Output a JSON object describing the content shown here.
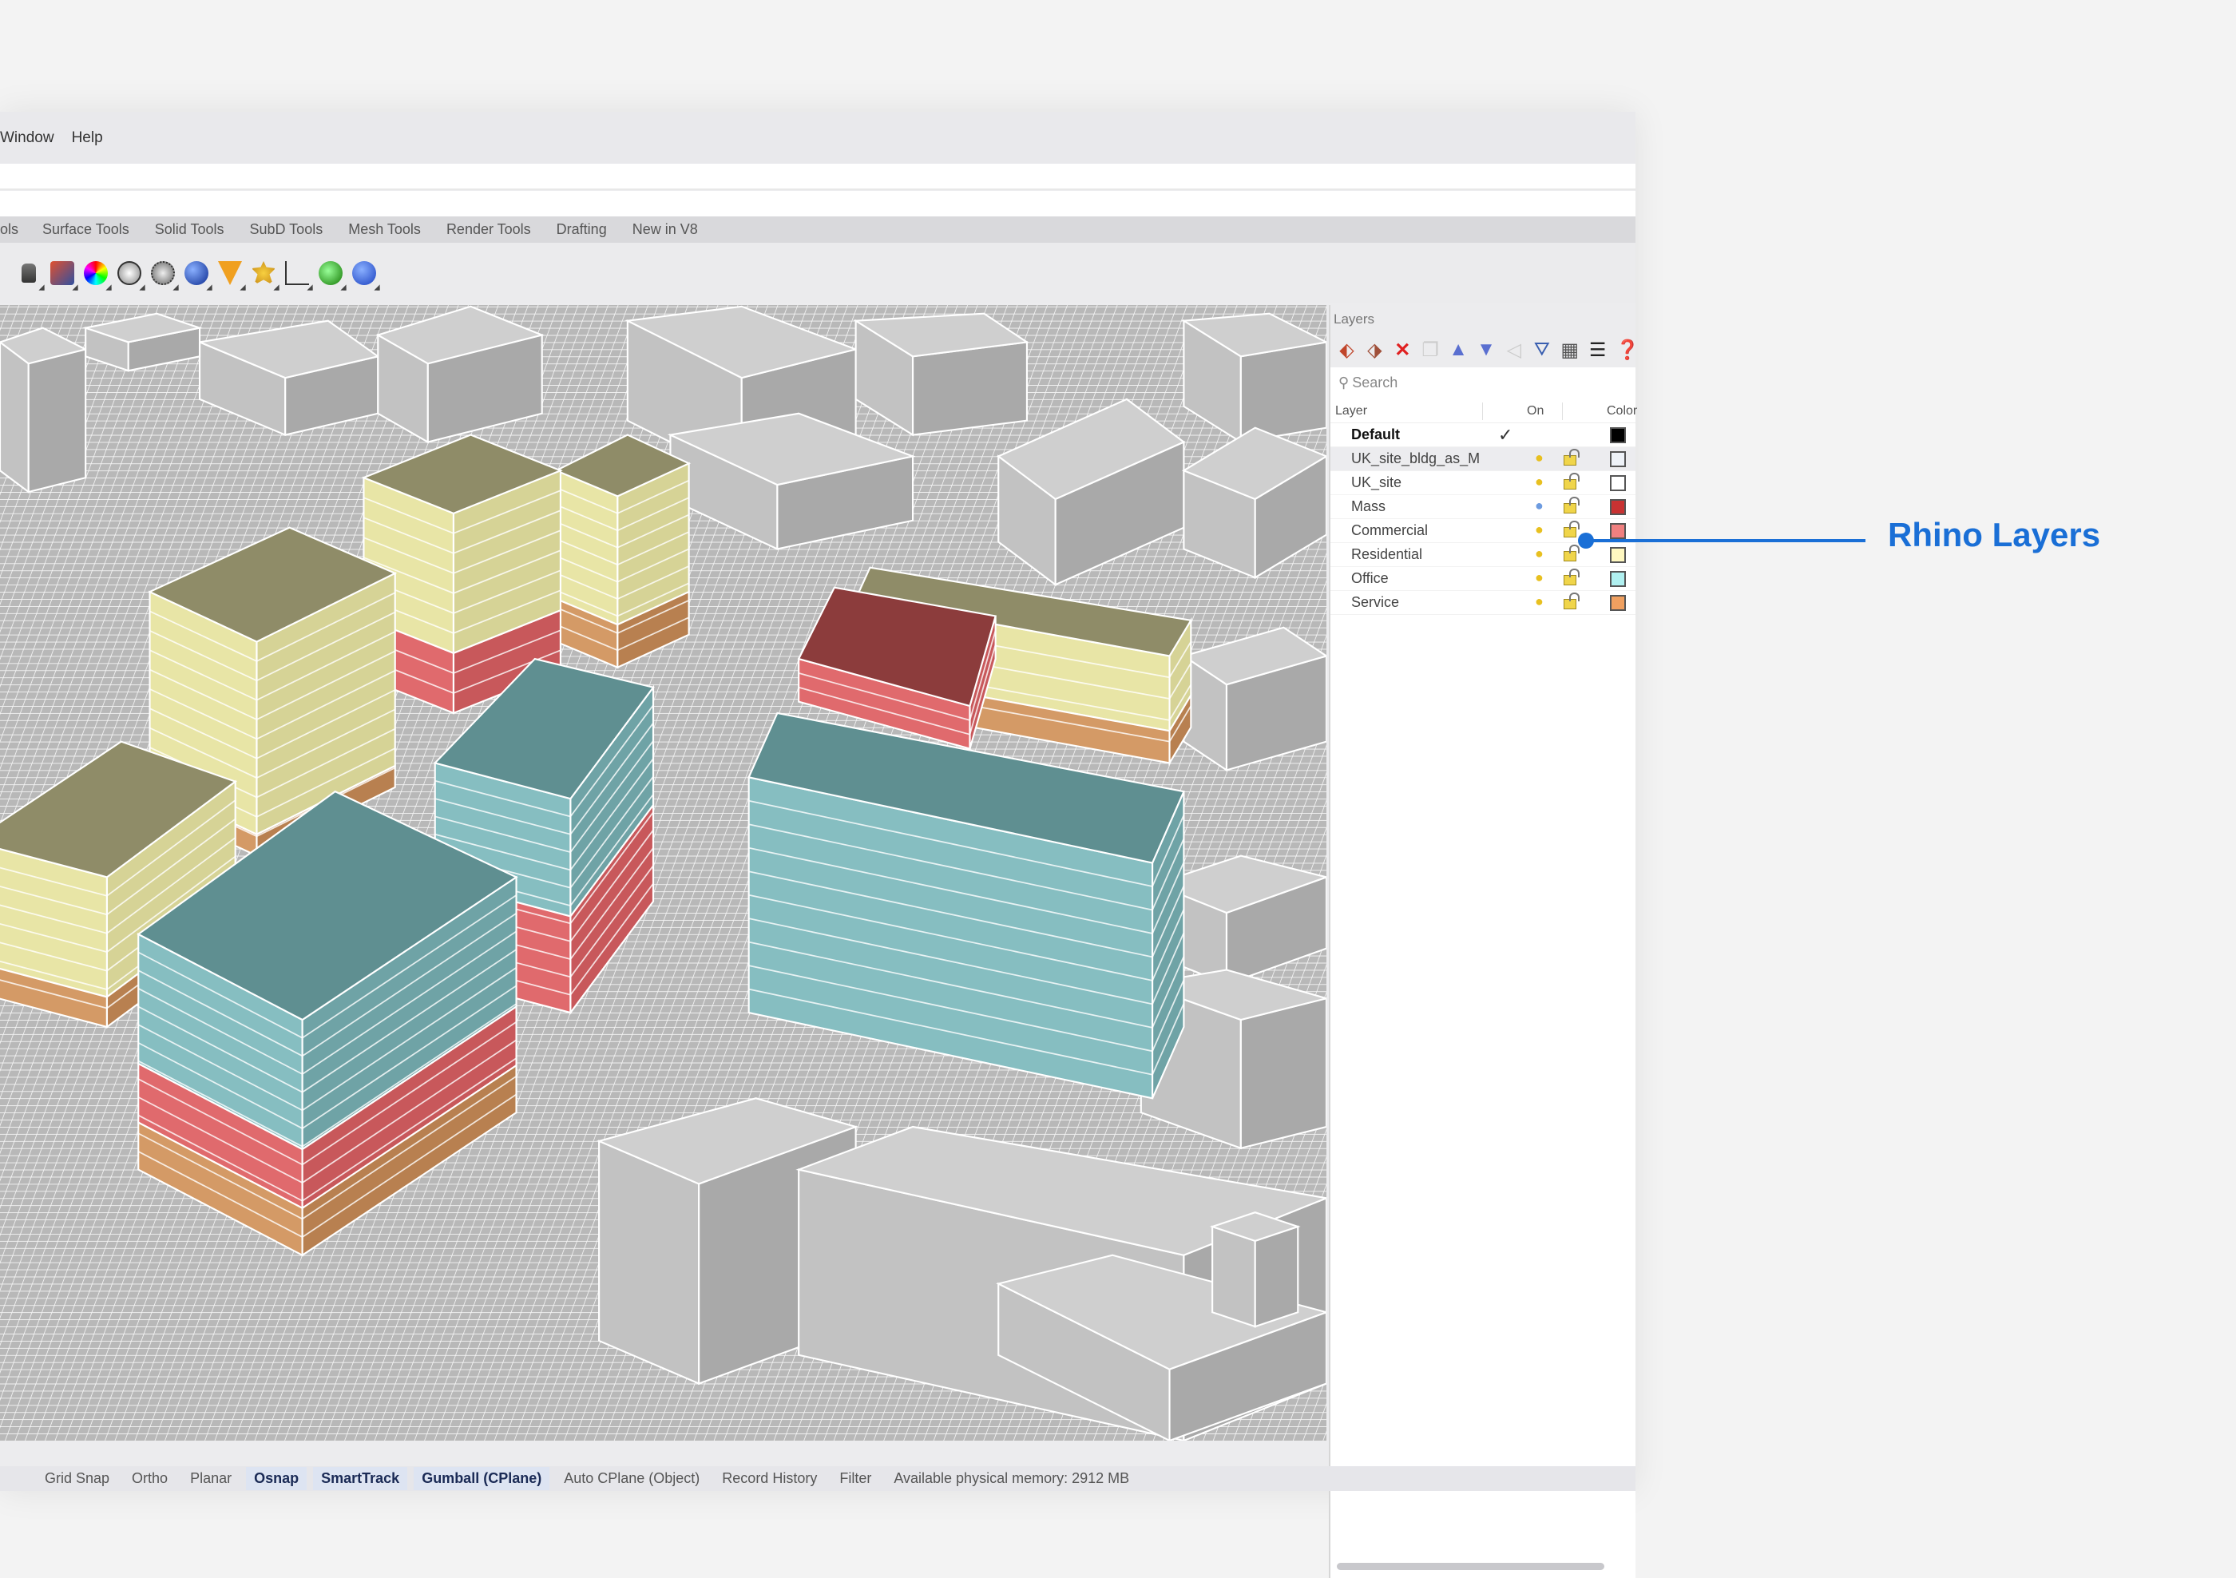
{
  "menu": [
    "Window",
    "Help"
  ],
  "tabs": [
    "ols",
    "Surface Tools",
    "Solid Tools",
    "SubD Tools",
    "Mesh Tools",
    "Render Tools",
    "Drafting",
    "New in V8"
  ],
  "toolbar_icons": [
    "lock-icon",
    "layer-icon",
    "color-wheel-icon",
    "sphere-wire-icon",
    "sphere-grid-icon",
    "sphere-render-icon",
    "light-icon",
    "gear-icon",
    "dimension-icon",
    "globe-icon",
    "help-icon"
  ],
  "layers": {
    "title": "Layers",
    "search_placeholder": "Search",
    "columns": {
      "layer": "Layer",
      "on": "On",
      "color": "Color"
    },
    "rows": [
      {
        "name": "Default",
        "current": true,
        "color": "#000000"
      },
      {
        "name": "UK_site_bldg_as_Mesh",
        "color": "#eef2f8",
        "bulb": "#e8c020"
      },
      {
        "name": "UK_site",
        "color": "#ffffff",
        "bulb": "#e8c020"
      },
      {
        "name": "Mass",
        "color": "#c83232",
        "bulb": "#6d9be0"
      },
      {
        "name": "Commercial",
        "color": "#f08080",
        "bulb": "#e8c020"
      },
      {
        "name": "Residential",
        "color": "#fff8c0",
        "bulb": "#e8c020"
      },
      {
        "name": "Office",
        "color": "#b0f0f0",
        "bulb": "#e8c020"
      },
      {
        "name": "Service",
        "color": "#f0a060",
        "bulb": "#e8c020"
      }
    ]
  },
  "status": [
    "Grid Snap",
    "Ortho",
    "Planar",
    "Osnap",
    "SmartTrack",
    "Gumball (CPlane)",
    "Auto CPlane (Object)",
    "Record History",
    "Filter",
    "Available physical memory: 2912 MB"
  ],
  "status_active": [
    3,
    4,
    5
  ],
  "callout": {
    "label": "Rhino Layers",
    "color": "#1a6fd6"
  }
}
